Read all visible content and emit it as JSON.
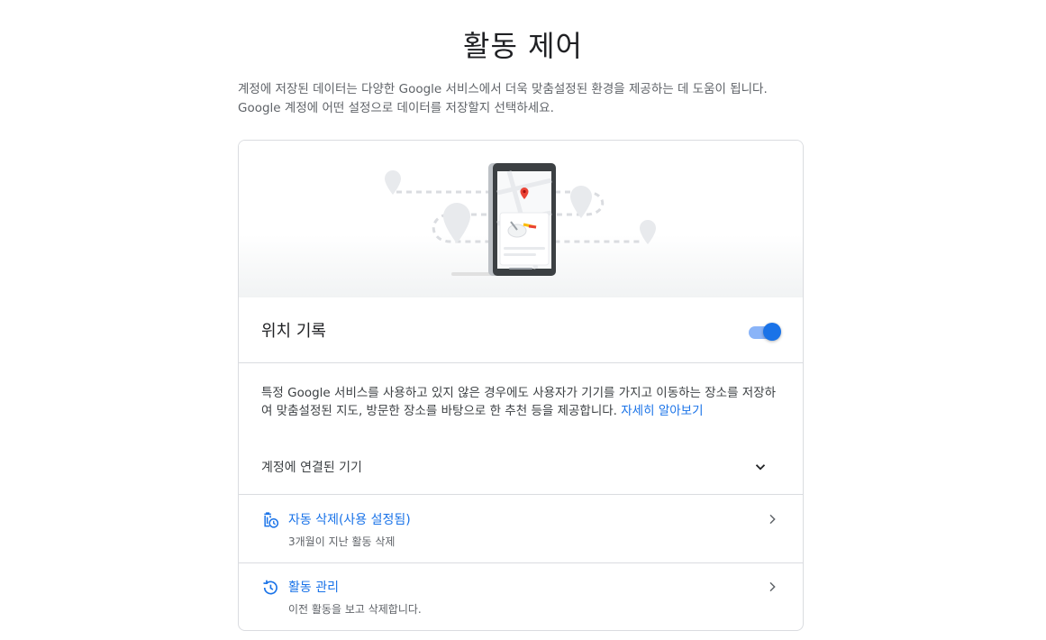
{
  "page": {
    "title": "활동 제어",
    "intro": "계정에 저장된 데이터는 다양한 Google 서비스에서 더욱 맞춤설정된 환경을 제공하는 데 도움이 됩니다. Google 계정에 어떤 설정으로 데이터를 저장할지 선택하세요."
  },
  "setting": {
    "title": "위치 기록",
    "enabled": true,
    "description": "특정 Google 서비스를 사용하고 있지 않은 경우에도 사용자가 기기를 가지고 이동하는 장소를 저장하여 맞춤설정된 지도, 방문한 장소를 바탕으로 한 추천 등을 제공합니다.",
    "learn_more": "자세히 알아보기",
    "devices_label": "계정에 연결된 기기"
  },
  "rows": {
    "auto_delete": {
      "title": "자동 삭제(사용 설정됨)",
      "subtitle": "3개월이 지난 활동 삭제",
      "icon": "auto-delete-icon"
    },
    "manage": {
      "title": "활동 관리",
      "subtitle": "이전 활동을 보고 삭제합니다.",
      "icon": "history-icon"
    }
  },
  "colors": {
    "accent": "#1a73e8",
    "toggle_track": "#8ab4f8",
    "border": "#dadce0",
    "secondary_text": "#5f6368"
  }
}
